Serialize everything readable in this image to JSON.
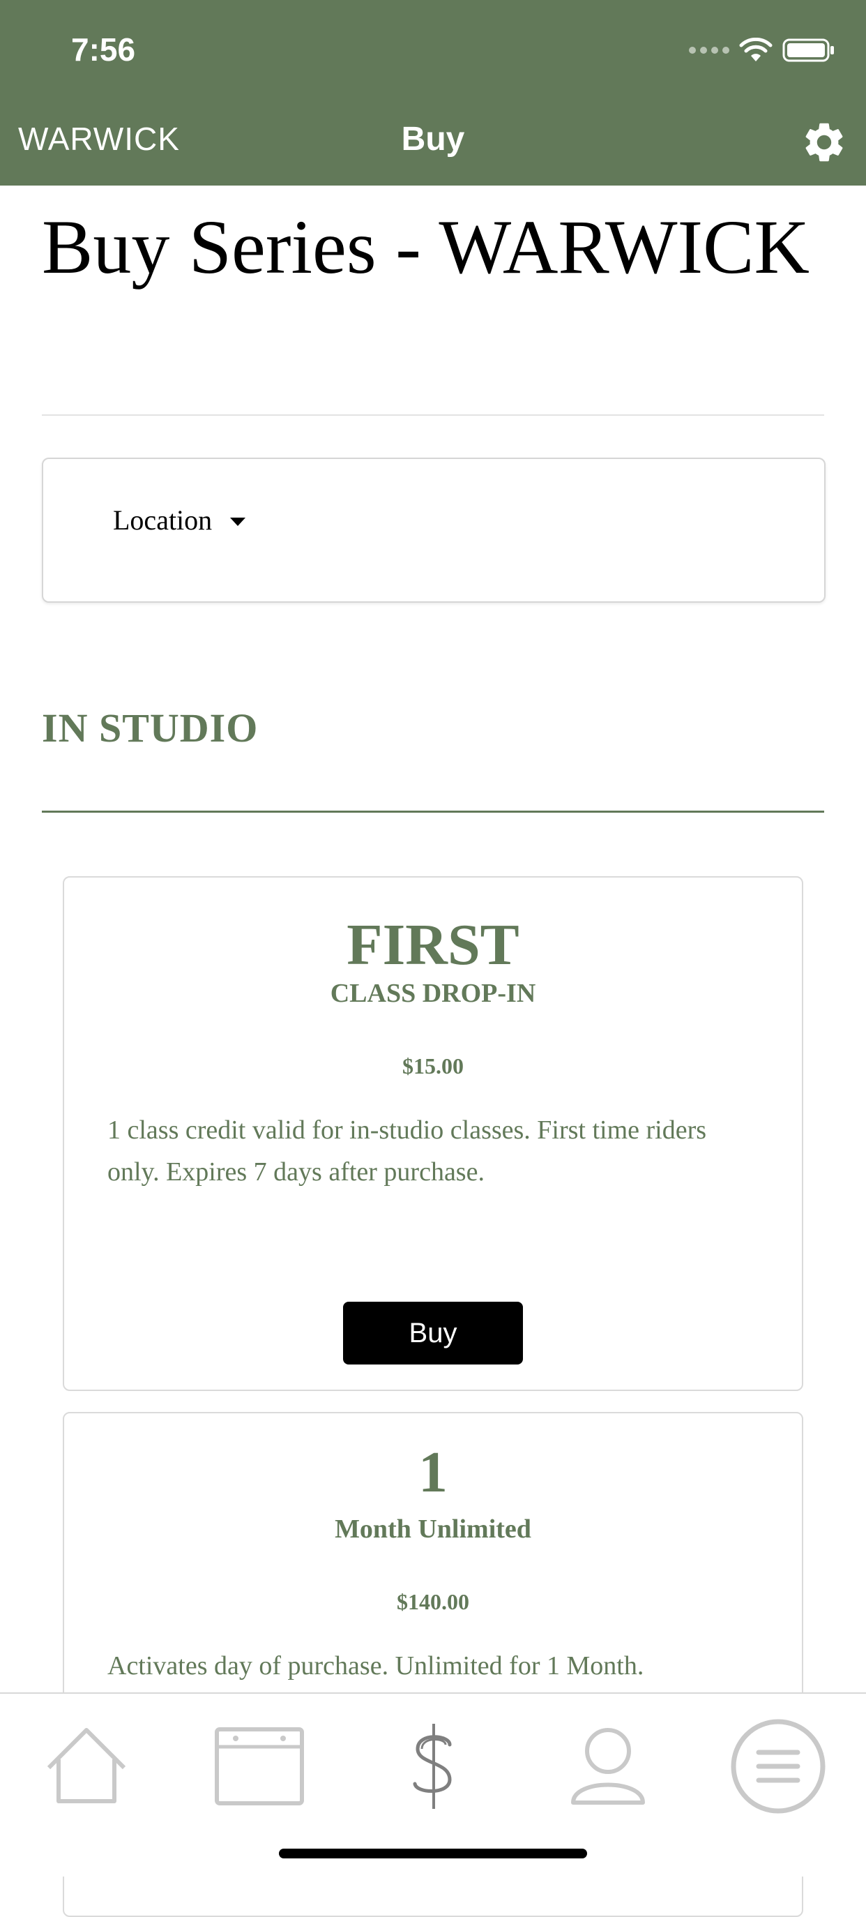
{
  "status_bar": {
    "time": "7:56"
  },
  "nav": {
    "left_label": "WARWICK",
    "title": "Buy",
    "settings_icon": "gear-icon"
  },
  "page": {
    "title": "Buy Series - WARWICK"
  },
  "filter": {
    "location_label": "Location"
  },
  "section": {
    "title": "IN STUDIO"
  },
  "series": [
    {
      "title": "FIRST",
      "subtitle": "CLASS DROP-IN",
      "price": "$15.00",
      "description": "1 class credit valid for in-studio classes. First time riders only. Expires 7 days after purchase.",
      "buy_label": "Buy"
    },
    {
      "title": "1",
      "subtitle": "Month Unlimited",
      "price": "$140.00",
      "description": "Activates day of purchase. Unlimited for 1 Month."
    }
  ],
  "tabbar": {
    "tabs": [
      {
        "icon": "home-icon"
      },
      {
        "icon": "calendar-icon"
      },
      {
        "icon": "dollar-icon"
      },
      {
        "icon": "profile-icon"
      },
      {
        "icon": "menu-icon"
      }
    ]
  },
  "colors": {
    "brand": "#627959",
    "header_bg": "#627959",
    "button_bg": "#000000"
  }
}
